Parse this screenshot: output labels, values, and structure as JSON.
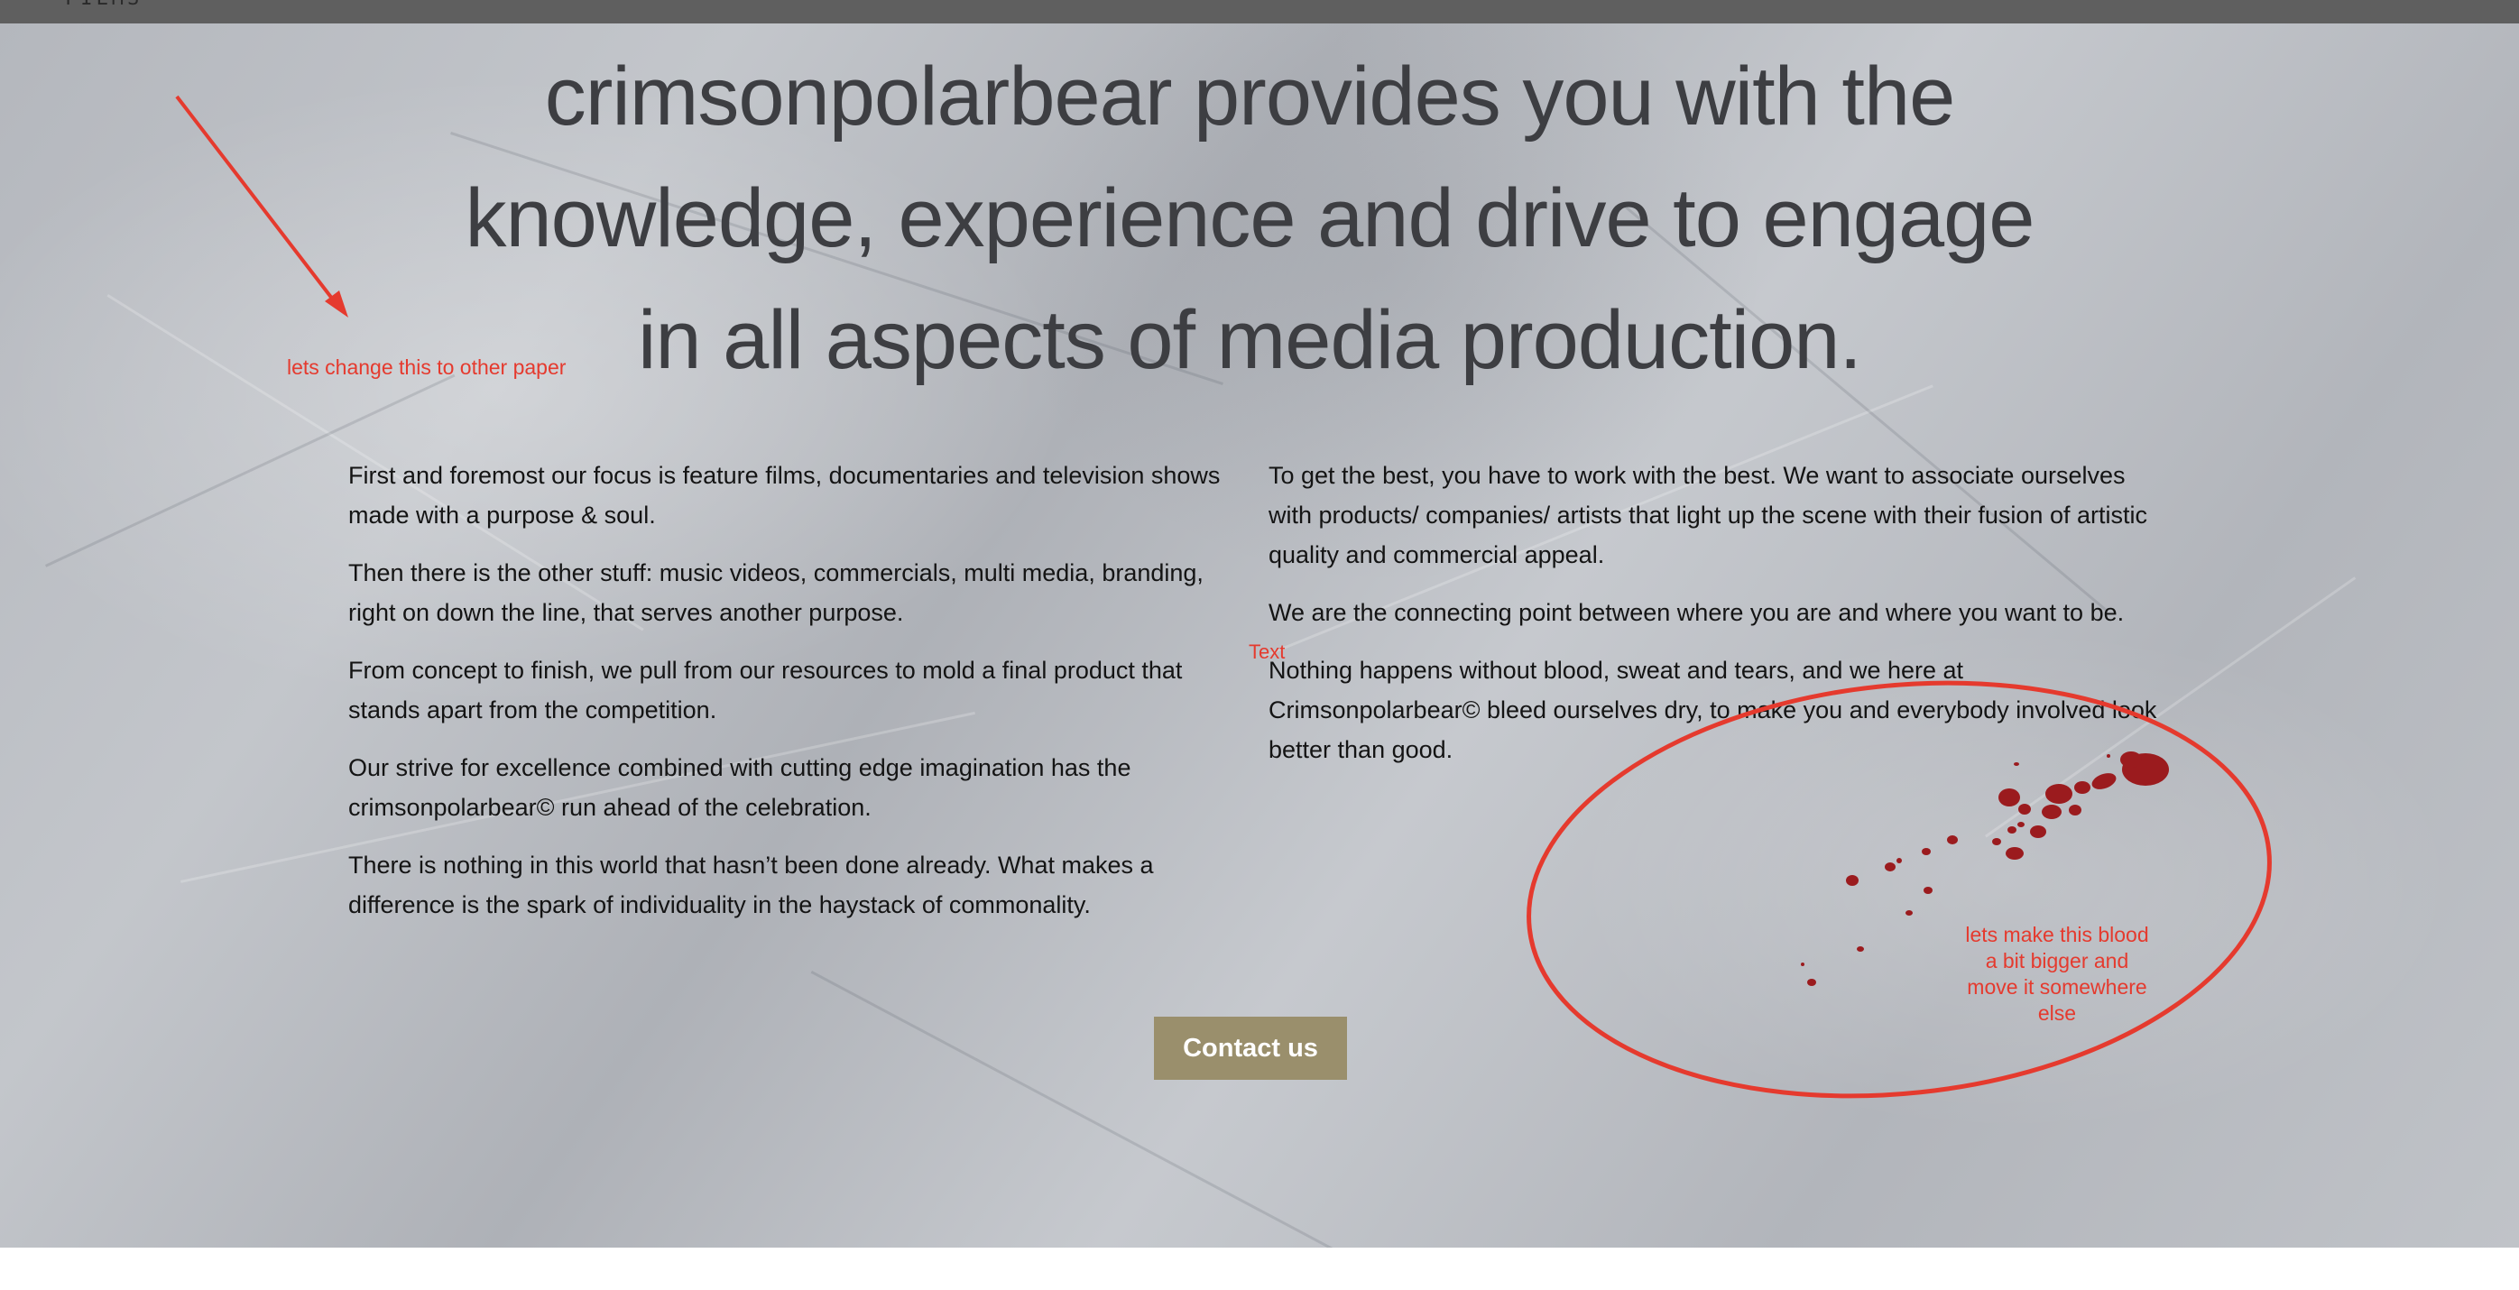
{
  "header": {
    "logo_text": "FILMS"
  },
  "hero": {
    "line1": "crimsonpolarbear provides you with the",
    "line2": "knowledge, experience and drive to engage",
    "line3": "in all aspects of media production."
  },
  "left_column": {
    "p1": "First and foremost our focus is feature films, documentaries and television shows made with a purpose & soul.",
    "p2": "Then there is the other stuff: music videos, commercials, multi media, branding, right on down the line, that serves another purpose.",
    "p3": "From concept to finish, we pull from our resources to mold a final product that stands apart from the competition.",
    "p4": "Our strive for excellence combined with cutting edge imagination has the crimsonpolarbear© run ahead of the celebration.",
    "p5": "There is nothing in this world that hasn’t been done already. What makes a difference is the spark of individuality in the haystack of commonality."
  },
  "right_column": {
    "p1": "To get the best, you have to work with the best. We want to associate ourselves with products/ companies/ artists that light up the scene with their fusion of artistic quality and commercial appeal.",
    "p2": "We are the connecting point between where you are and where you want to be.",
    "p3": "Nothing happens without blood, sweat and tears, and we here at Crimsonpolarbear© bleed ourselves dry, to make you and everybody involved look better than good."
  },
  "cta": {
    "label": "Contact us"
  },
  "annotations": {
    "paper_note": "lets change this to other paper",
    "text_marker": "Text",
    "blood_note": "lets make this blood a bit bigger and move it somewhere else",
    "color": "#e53a2e"
  },
  "colors": {
    "topbar": "#5f5f5f",
    "headline": "#3d3e42",
    "button": "#9a8f6c",
    "blood": "#9b1b1e"
  }
}
